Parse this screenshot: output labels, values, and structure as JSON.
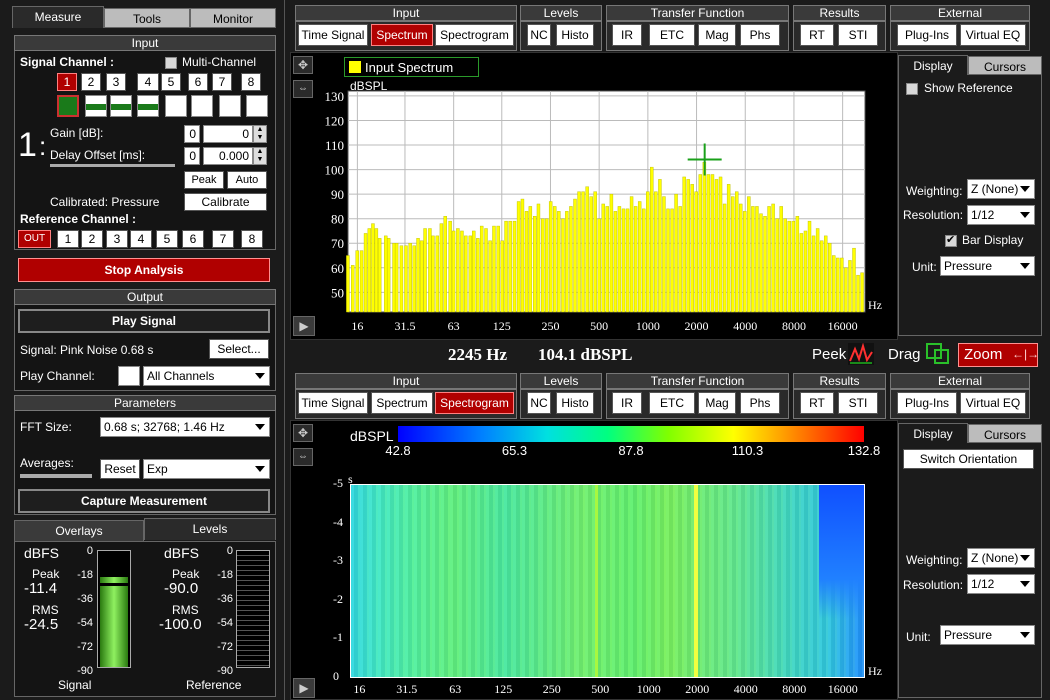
{
  "main_tabs": {
    "measure": "Measure",
    "tools": "Tools",
    "monitor": "Monitor"
  },
  "input_section": {
    "title": "Input",
    "signal_channel_label": "Signal Channel :",
    "multi_channel_label": "Multi-Channel",
    "channels": [
      "1",
      "2",
      "3",
      "4",
      "5",
      "6",
      "7",
      "8"
    ],
    "channel_number": "1",
    "channel_separator": ":",
    "gain_label": "Gain [dB]:",
    "delay_label": "Delay Offset [ms]:",
    "gain_a": "0",
    "gain_b": "0",
    "delay_a": "0",
    "delay_b": "0.000",
    "peak_btn": "Peak",
    "auto_btn": "Auto",
    "calibrated_label": "Calibrated: Pressure",
    "calibrate_btn": "Calibrate",
    "reference_label": "Reference Channel :",
    "ref_out": "OUT",
    "ref_channels": [
      "1",
      "2",
      "3",
      "4",
      "5",
      "6",
      "7",
      "8"
    ]
  },
  "stop_analysis": "Stop Analysis",
  "output_section": {
    "title": "Output",
    "play_signal": "Play Signal",
    "signal_text": "Signal: Pink Noise  0.68 s",
    "select_btn": "Select...",
    "play_channel_label": "Play Channel:",
    "play_channel_value": "All Channels"
  },
  "parameters": {
    "title": "Parameters",
    "fft_label": "FFT Size:",
    "fft_value": "0.68 s; 32768; 1.46 Hz",
    "averages_label": "Averages:",
    "reset_btn": "Reset",
    "avg_value": "Exp",
    "capture_btn": "Capture Measurement"
  },
  "meters": {
    "tab_overlays": "Overlays",
    "tab_levels": "Levels",
    "unit": "dBFS",
    "scale": [
      "0",
      "-18",
      "-36",
      "-54",
      "-72",
      "-90"
    ],
    "signal": {
      "peak_label": "Peak",
      "peak": "-11.4",
      "rms_label": "RMS",
      "rms": "-24.5",
      "caption": "Signal",
      "level_fraction": 0.78
    },
    "reference": {
      "peak_label": "Peak",
      "peak": "-90.0",
      "rms_label": "RMS",
      "rms": "-100.0",
      "caption": "Reference"
    }
  },
  "toolbar_top": {
    "groups": [
      "Input",
      "Levels",
      "Transfer Function",
      "Results",
      "External"
    ],
    "buttons": [
      "Time Signal",
      "Spectrum",
      "Spectrogram",
      "NC",
      "Histo",
      "IR",
      "ETC",
      "Mag",
      "Phs",
      "RT",
      "STI",
      "Plug-Ins",
      "Virtual EQ"
    ],
    "active": "Spectrum"
  },
  "toolbar_bottom": {
    "groups": [
      "Input",
      "Levels",
      "Transfer Function",
      "Results",
      "External"
    ],
    "buttons": [
      "Time Signal",
      "Spectrum",
      "Spectrogram",
      "NC",
      "Histo",
      "IR",
      "ETC",
      "Mag",
      "Phs",
      "RT",
      "STI",
      "Plug-Ins",
      "Virtual EQ"
    ],
    "active": "Spectrogram"
  },
  "spectrum_side": {
    "tab_display": "Display",
    "tab_cursors": "Cursors",
    "show_reference": "Show Reference",
    "weighting_label": "Weighting:",
    "weighting_value": "Z (None)",
    "resolution_label": "Resolution:",
    "resolution_value": "1/12",
    "bar_display": "Bar Display",
    "unit_label": "Unit:",
    "unit_value": "Pressure"
  },
  "spectrogram_side": {
    "tab_display": "Display",
    "tab_cursors": "Cursors",
    "switch_orientation": "Switch Orientation",
    "weighting_label": "Weighting:",
    "weighting_value": "Z (None)",
    "resolution_label": "Resolution:",
    "resolution_value": "1/12",
    "unit_label": "Unit:",
    "unit_value": "Pressure"
  },
  "readout": {
    "freq": "2245 Hz",
    "level": "104.1 dBSPL",
    "peek": "Peek",
    "drag": "Drag",
    "zoom": "Zoom"
  },
  "colorbar": {
    "unit": "dBSPL",
    "ticks": [
      "42.8",
      "65.3",
      "87.8",
      "110.3",
      "132.8"
    ]
  },
  "spectrogram_axis": {
    "unit": "s",
    "yticks": [
      "-5",
      "-4",
      "-3",
      "-2",
      "-1",
      "0"
    ],
    "xunit": "Hz",
    "xticks": [
      "16",
      "31.5",
      "63",
      "125",
      "250",
      "500",
      "1000",
      "2000",
      "4000",
      "8000",
      "16000"
    ]
  },
  "chart_data": {
    "type": "bar",
    "legend": "Input Spectrum",
    "ylabel": "dBSPL",
    "xlabel": "Hz",
    "ylim": [
      42,
      132
    ],
    "xlim_hz": [
      14,
      22000
    ],
    "x_scale": "log",
    "yticks": [
      50,
      60,
      70,
      80,
      90,
      100,
      110,
      120,
      130
    ],
    "xticks": [
      "16",
      "31.5",
      "63",
      "125",
      "250",
      "500",
      "1000",
      "2000",
      "4000",
      "8000",
      "16000"
    ],
    "grid": true,
    "bar_color": "#ffff00",
    "cursor": {
      "x": 2245,
      "y": 104.1
    },
    "frequencies_hz": [
      14,
      15,
      16,
      17,
      18,
      19,
      20,
      21,
      22,
      24,
      25,
      27,
      28,
      30,
      32,
      34,
      36,
      38,
      40,
      42,
      45,
      47,
      50,
      53,
      56,
      60,
      63,
      67,
      71,
      75,
      80,
      84,
      89,
      94,
      100,
      106,
      112,
      119,
      126,
      133,
      141,
      150,
      159,
      168,
      178,
      188,
      200,
      211,
      224,
      237,
      251,
      266,
      282,
      299,
      316,
      335,
      355,
      376,
      398,
      422,
      447,
      473,
      501,
      531,
      562,
      596,
      631,
      668,
      708,
      750,
      794,
      841,
      891,
      944,
      1000,
      1059,
      1122,
      1189,
      1259,
      1334,
      1413,
      1496,
      1585,
      1679,
      1778,
      1884,
      1995,
      2113,
      2239,
      2371,
      2512,
      2661,
      2818,
      2985,
      3162,
      3350,
      3548,
      3758,
      3981,
      4217,
      4467,
      4732,
      5012,
      5309,
      5623,
      5957,
      6310,
      6683,
      7079,
      7499,
      7943,
      8414,
      8913,
      9441,
      10000,
      10593,
      11220,
      11885,
      12589,
      13335,
      14125,
      14962,
      15849,
      16788,
      17783,
      18836,
      19953,
      21135
    ],
    "values_db": [
      65,
      61,
      67,
      67,
      74,
      76,
      78,
      76,
      72,
      73,
      72,
      70,
      70,
      69,
      69,
      70,
      69,
      72,
      71,
      76,
      76,
      73,
      73,
      78,
      81,
      79,
      75,
      76,
      75,
      73,
      73,
      75,
      72,
      77,
      76,
      71,
      77,
      77,
      71,
      79,
      79,
      79,
      87,
      88,
      83,
      85,
      81,
      86,
      80,
      80,
      87,
      85,
      83,
      80,
      83,
      85,
      88,
      91,
      91,
      93,
      89,
      91,
      80,
      86,
      85,
      90,
      83,
      85,
      84,
      84,
      89,
      85,
      87,
      84,
      91,
      101,
      91,
      96,
      89,
      84,
      84,
      90,
      85,
      97,
      96,
      94,
      91,
      98,
      103,
      98,
      98,
      96,
      97,
      86,
      94,
      89,
      91,
      86,
      83,
      89,
      85,
      85,
      82,
      81,
      85,
      86,
      80,
      85,
      80,
      79,
      79,
      81,
      74,
      75,
      79,
      73,
      76,
      71,
      73,
      70,
      65,
      64,
      64,
      60,
      63,
      68,
      57,
      58
    ]
  }
}
